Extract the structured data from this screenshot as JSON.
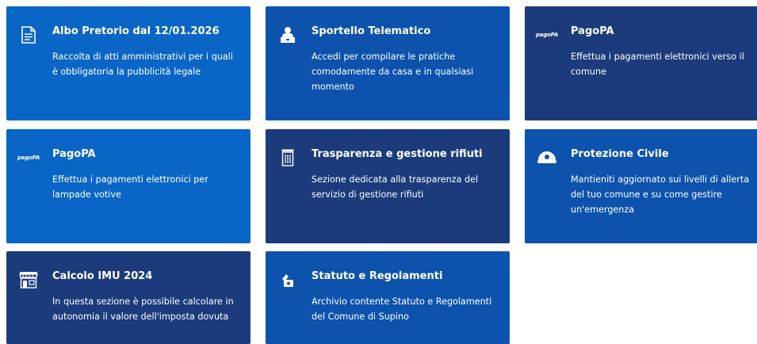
{
  "cards": [
    {
      "title": "Albo Pretorio dal 12/01.2026",
      "desc": "Raccolta di atti amministrativi per i quali è obbligatoria la pubblicità legale",
      "icon": "document-icon"
    },
    {
      "title": "Sportello Telematico",
      "desc": "Accedi per compilare le pratiche comodamente da casa e in qualsiasi momento",
      "icon": "clerk-icon"
    },
    {
      "title": "PagoPA",
      "desc": "Effettua i pagamenti elettronici verso il comune",
      "icon": "pagopa-logo-icon",
      "logo_text": "pagoPA"
    },
    {
      "title": "PagoPA",
      "desc": "Effettua i pagamenti elettronici per lampade votive",
      "icon": "pagopa-logo-icon",
      "logo_text": "pagoPA"
    },
    {
      "title": "Trasparenza e gestione rifiuti",
      "desc": "Sezione dedicata alla trasparenza del servizio di gestione rifiuti",
      "icon": "trash-bin-icon"
    },
    {
      "title": "Protezione Civile",
      "desc": "Mantieniti aggiornato sui livelli di allerta del tuo comune e su come gestire un'emergenza",
      "icon": "civil-protection-icon"
    },
    {
      "title": "Calcolo IMU 2024",
      "desc": "In questa sezione è possibile calcolare in autonomia il valore dell'imposta dovuta",
      "icon": "shop-icon"
    },
    {
      "title": "Statuto e Regolamenti",
      "desc": "Archivio contente Statuto e Regolamenti del Comune di Supino",
      "icon": "regulations-icon"
    }
  ],
  "colors": {
    "bright_blue": "#0a66c6",
    "mid_blue": "#0d53ad",
    "dark_blue": "#1b3b7c",
    "text": "#ffffff"
  }
}
